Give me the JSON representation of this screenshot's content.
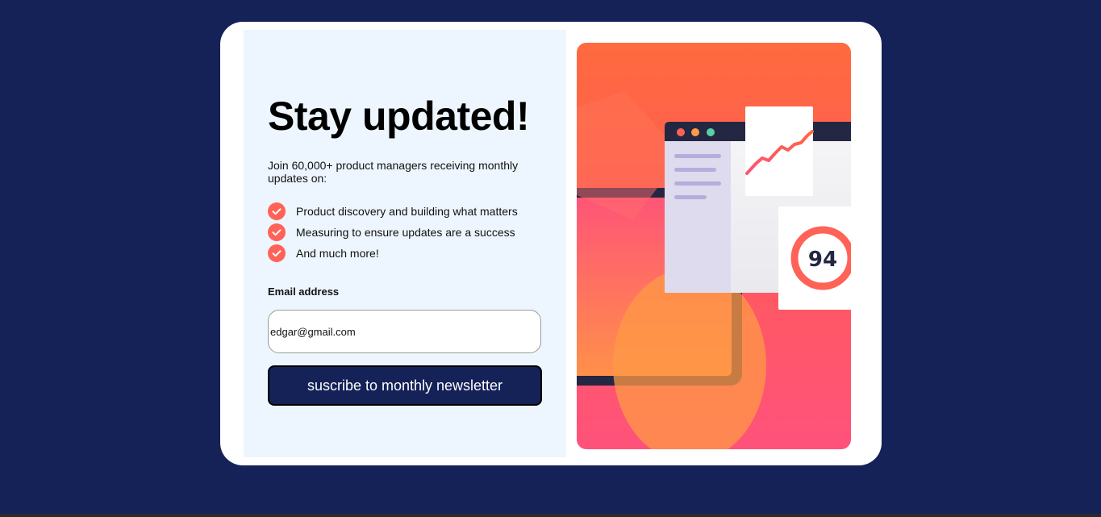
{
  "signup": {
    "title": "Stay updated!",
    "intro": "Join 60,000+ product managers receiving monthly updates on:",
    "features": [
      "Product discovery and building what matters",
      "Measuring to ensure updates are a success",
      "And much more!"
    ],
    "email_label": "Email address",
    "email_value": "edgar@gmail.com",
    "button_label": "suscribe to monthly newsletter"
  },
  "illustration": {
    "score": "94"
  },
  "colors": {
    "page_background": "#142257",
    "card_background": "#ffffff",
    "panel_background": "#edf6fe",
    "accent": "#ff6257",
    "button": "#142257"
  },
  "icons": {
    "feature_check": "check-circle-icon"
  }
}
